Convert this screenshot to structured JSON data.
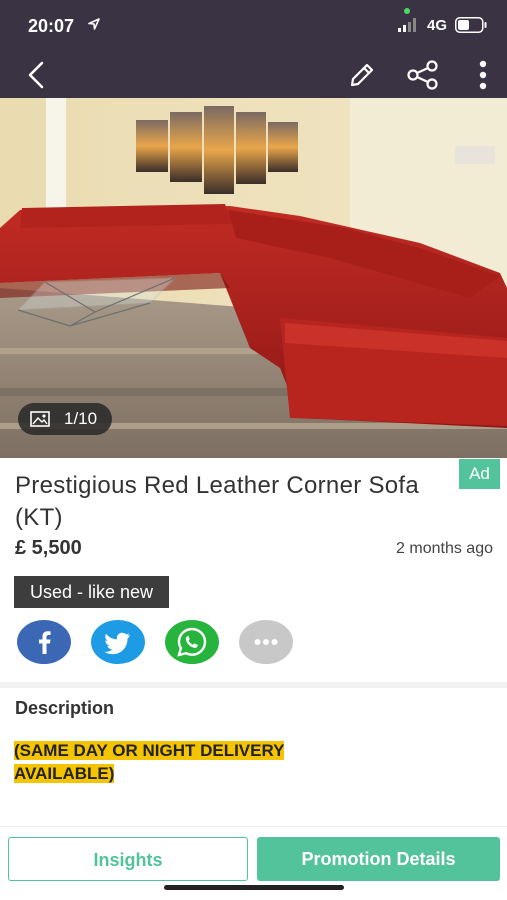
{
  "status_bar": {
    "time": "20:07",
    "network": "4G"
  },
  "photo": {
    "counter": "1/10"
  },
  "listing": {
    "badge": "Ad",
    "title": "Prestigious Red Leather Corner Sofa (KT)",
    "price": "£ 5,500",
    "posted": "2 months ago",
    "condition": "Used - like new"
  },
  "share": {
    "items": [
      "facebook-icon",
      "twitter-icon",
      "whatsapp-icon",
      "more-icon"
    ],
    "colors": {
      "facebook": "#3b67b5",
      "twitter": "#1d9be5",
      "whatsapp": "#27b43d",
      "more": "#c8c8c8"
    }
  },
  "description": {
    "label": "Description",
    "text_line1": "(SAME DAY OR NIGHT DELIVERY",
    "text_line2": "AVAILABLE)"
  },
  "actions": {
    "insights": "Insights",
    "promotion": "Promotion Details"
  },
  "colors": {
    "header_bg": "#3a3343",
    "accent": "#53c39b",
    "highlight": "#f5c400"
  }
}
